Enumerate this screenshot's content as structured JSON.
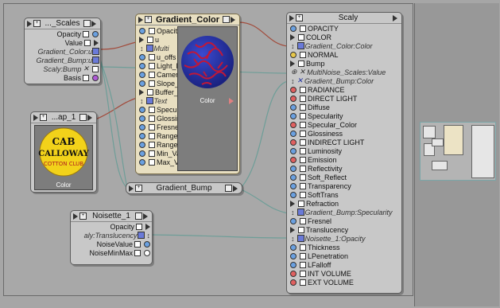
{
  "scales_node": {
    "title": "..._Scales",
    "rows": [
      "Opacity",
      "Value",
      "Gradient_Color:u",
      "Gradient_Bump:u",
      "Scaly:Bump",
      "Basis"
    ]
  },
  "map_node": {
    "title": "...ap_1",
    "label": "Color",
    "logo_text": [
      "CAB",
      "CALLOWAY",
      "COTTON CLUB"
    ]
  },
  "gradient_color": {
    "title": "Gradient_Color",
    "rows": [
      "Opacit",
      "u",
      "Multi",
      "u_offs",
      "Light_F",
      "Camer",
      "Slope_",
      "Buffer_",
      "Text",
      "Specul",
      "Glossin",
      "Fresne",
      "Range_",
      "Range_",
      "Min_Va",
      "Max_V"
    ],
    "preview_label": "Color"
  },
  "gradient_bump": {
    "title": "Gradient_Bump"
  },
  "noisette": {
    "title": "Noisette_1",
    "rows": [
      "Opacity",
      "aly:Translucency",
      "NoiseValue",
      "NoiseMinMax"
    ]
  },
  "scaly": {
    "title": "Scaly",
    "rows": [
      "OPACITY",
      "COLOR",
      "Gradient_Color:Color",
      "NORMAL",
      "Bump",
      "MultiNoise_Scales:Value",
      "Gradient_Bump:Color",
      "RADIANCE",
      "DIRECT LIGHT",
      "Diffuse",
      "Specularity",
      "Specular_Color",
      "Glossiness",
      "INDIRECT LIGHT",
      "Luminosity",
      "Emission",
      "Reflectivity",
      "Soft_Reflect",
      "Transparency",
      "SoftTrans",
      "Refraction",
      "Gradient_Bump:Specularity",
      "Fresnel",
      "Translucency",
      "Noisette_1:Opacity",
      "Thickness",
      "LPenetration",
      "LFalloff",
      "INT VOLUME",
      "EXT VOLUME"
    ]
  },
  "colors": {
    "sphere_blue": "#2a3aa8",
    "sphere_red": "#c01838",
    "logo_yellow": "#f2d21a",
    "selected_node": "#e8dfc1"
  }
}
